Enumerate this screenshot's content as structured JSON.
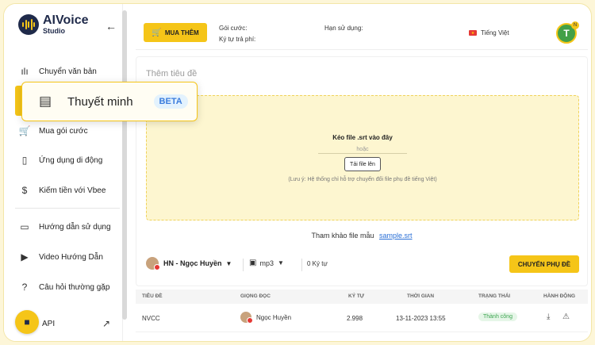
{
  "app": {
    "logo_title": "AIVoice",
    "logo_sub": "Studio",
    "brand_color": "#f5c518"
  },
  "sidebar": {
    "items": [
      {
        "label": "Chuyển văn bản",
        "icon": "waveform-icon"
      },
      {
        "label": "Thuyết minh",
        "icon": "subtitle-icon"
      },
      {
        "label": "Mua gói cước",
        "icon": "cart-icon"
      },
      {
        "label": "Ứng dụng di động",
        "icon": "mobile-icon"
      },
      {
        "label": "Kiếm tiền với Vbee",
        "icon": "dollar-icon"
      },
      {
        "label": "Hướng dẫn sử dụng",
        "icon": "folder-icon"
      },
      {
        "label": "Video Hướng Dẫn",
        "icon": "video-icon"
      },
      {
        "label": "Câu hỏi thường gặp",
        "icon": "help-icon"
      }
    ],
    "api_label": "API"
  },
  "highlight": {
    "label": "Thuyết minh",
    "badge": "BETA"
  },
  "topbar": {
    "buy_label": "MUA THÊM",
    "plan_label": "Gói cước:",
    "chars_label": "Ký tự trả phí:",
    "expire_label": "Hạn sử dụng:",
    "language": "Tiếng Việt",
    "avatar_initial": "T",
    "avatar_badge": "N"
  },
  "editor": {
    "title_placeholder": "Thêm tiêu đề",
    "drop_title": "Kéo file .srt vào đây",
    "or_label": "hoặc",
    "upload_label": "Tải file lên",
    "note": "(Lưu ý: Hệ thống chỉ hỗ trợ chuyển đổi file phụ đề tiếng Việt)",
    "sample_prefix": "Tham khảo file mẫu",
    "sample_link": "sample.srt",
    "voice": "HN - Ngọc Huyền",
    "format": "mp3",
    "chars_count": "0 Ký tự",
    "convert_label": "CHUYỂN PHỤ ĐỀ"
  },
  "table": {
    "headers": [
      "TIÊU ĐỀ",
      "GIỌNG ĐỌC",
      "KÝ TỰ",
      "THỜI GIAN",
      "TRẠNG THÁI",
      "HÀNH ĐỘNG"
    ],
    "rows": [
      {
        "title": "NVCC",
        "voice": "Ngọc Huyền",
        "chars": "2.998",
        "time": "13-11-2023 13:55",
        "status": "Thành công"
      }
    ]
  }
}
